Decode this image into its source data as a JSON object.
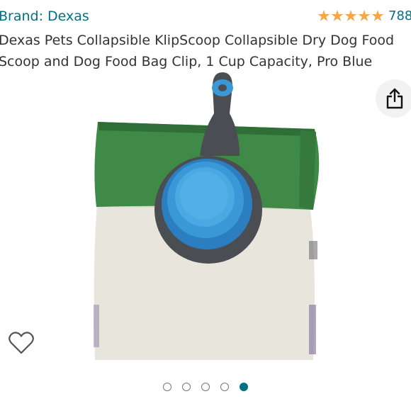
{
  "brand": {
    "label": "Brand: Dexas"
  },
  "rating": {
    "stars": 5,
    "count_text": "788"
  },
  "product": {
    "title": "Dexas Pets Collapsible KlipScoop Collapsible Dry Dog Food Scoop and Dog Food Bag Clip, 1 Cup Capacity, Pro Blue"
  },
  "icons": {
    "share": "share-icon",
    "wishlist": "heart-outline-icon"
  },
  "carousel": {
    "total": 5,
    "active_index": 4
  },
  "colors": {
    "link": "#007185",
    "star": "#f3a847",
    "scoop_blue": "#3a98d6",
    "bag_green": "#3f8a46"
  }
}
